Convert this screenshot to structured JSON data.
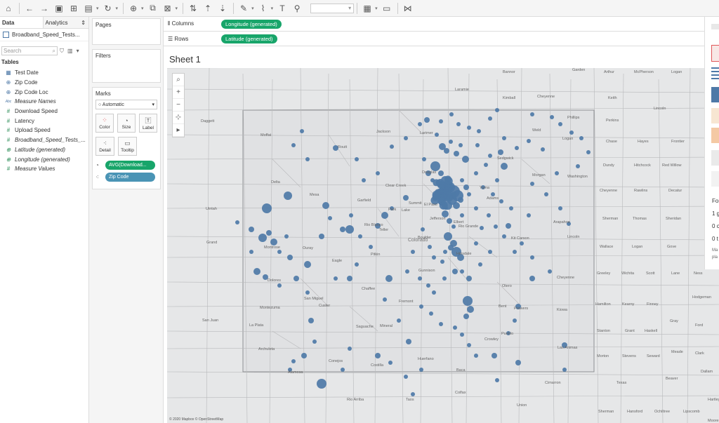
{
  "toolbar": {
    "icons": [
      "tableau-logo-icon",
      "back-icon",
      "forward-icon",
      "save-icon",
      "new-datasource-icon",
      "pause-icon",
      "refresh-icon",
      "new-sheet-icon",
      "duplicate-icon",
      "clear-icon",
      "swap-icon",
      "sort-asc-icon",
      "sort-desc-icon",
      "highlight-icon",
      "group-icon",
      "label-icon",
      "fix-axes-icon",
      "fit-icon",
      "show-cards-icon",
      "presentation-icon",
      "share-icon"
    ],
    "fit_value": ""
  },
  "data_pane": {
    "tab_data": "Data",
    "tab_analytics": "Analytics",
    "datasource": "Broadband_Speed_Tests...",
    "search_placeholder": "Search",
    "tables_heading": "Tables",
    "fields": [
      {
        "label": "Test Date",
        "icon": "calendar-icon"
      },
      {
        "label": "Zip Code",
        "icon": "globe-icon"
      },
      {
        "label": "Zip Code Loc",
        "icon": "globe-icon"
      },
      {
        "label": "Measure Names",
        "icon": "abc-icon"
      },
      {
        "label": "Download Speed",
        "icon": "hash-icon"
      },
      {
        "label": "Latency",
        "icon": "hash-icon"
      },
      {
        "label": "Upload Speed",
        "icon": "hash-icon"
      },
      {
        "label": "Broadband_Speed_Tests_...",
        "icon": "hash-icon"
      },
      {
        "label": "Latitude (generated)",
        "icon": "globe-icon"
      },
      {
        "label": "Longitude (generated)",
        "icon": "globe-icon"
      },
      {
        "label": "Measure Values",
        "icon": "hash-icon"
      }
    ]
  },
  "cards": {
    "pages": "Pages",
    "filters": "Filters",
    "marks": "Marks",
    "mark_type": "Automatic",
    "buttons": {
      "color": "Color",
      "size": "Size",
      "label": "Label",
      "detail": "Detail",
      "tooltip": "Tooltip"
    },
    "size_pill": "AVG(Download...",
    "detail_pill": "Zip Code"
  },
  "shelves": {
    "columns_label": "Columns",
    "columns_pill": "Longitude (generated)",
    "rows_label": "Rows",
    "rows_pill": "Latitude (generated)"
  },
  "sheet": {
    "title": "Sheet 1",
    "attribution": "© 2020 Mapbox © OpenStreetMap",
    "mark_color": "#4e79a7"
  },
  "map_labels": [
    "Bannor",
    "Garden",
    "Arthur",
    "McPherson",
    "Logan",
    "Laramie",
    "Kimball",
    "Cheyenne",
    "Keith",
    "Lincoln",
    "Perkins",
    "Chase",
    "Hayes",
    "Frontier",
    "Dundy",
    "Hitchcock",
    "Red Willow",
    "Cheyenne",
    "Rawlins",
    "Decatur",
    "Sherman",
    "Thomas",
    "Sheridan",
    "Wallace",
    "Logan",
    "Gove",
    "Greeley",
    "Wichita",
    "Scott",
    "Lane",
    "Ness",
    "Hamilton",
    "Kearny",
    "Finney",
    "Hodgeman",
    "Stanton",
    "Grant",
    "Haskell",
    "Gray",
    "Ford",
    "Morton",
    "Stevens",
    "Seward",
    "Meade",
    "Clark",
    "Cimarron",
    "Texas",
    "Beaver",
    "Sherman",
    "Hansford",
    "Ochiltree",
    "Lipscomb",
    "Dallam",
    "Hartley",
    "Moore",
    "Hutchinson",
    "Roberts",
    "Colfax",
    "Union",
    "Rio Arriba",
    "Taos",
    "Mora",
    "San Juan",
    "Grand",
    "Uintah",
    "Daggett",
    "Moffat",
    "Routt",
    "Jackson",
    "Larimer",
    "Weld",
    "Logan",
    "Phillips",
    "Sedgwick",
    "Morgan",
    "Washington",
    "Yuma",
    "Adams",
    "Arapahoe",
    "Kit Carson",
    "Lincoln",
    "Cheyenne",
    "Kiowa",
    "Prowers",
    "Bent",
    "Otero",
    "Crowley",
    "Pueblo",
    "Las Animas",
    "Baca",
    "Huerfano",
    "Costilla",
    "Conejos",
    "Alamosa",
    "Archuleta",
    "La Plata",
    "Montezuma",
    "Dolores",
    "San Miguel",
    "Montrose",
    "Ouray",
    "Mesa",
    "Delta",
    "Garfield",
    "Rio Blanco",
    "Eagle",
    "Pitkin",
    "Gunnison",
    "Chaffee",
    "Fremont",
    "Saguache",
    "Custer",
    "Mineral",
    "Rio Grande",
    "Hinsdale",
    "Elbert",
    "El Paso",
    "Douglas",
    "Jefferson",
    "Boulder",
    "Teller",
    "Park",
    "Lake",
    "Summit",
    "Clear Creek",
    "Gilpin",
    "Grand"
  ],
  "state_label": "Colorado",
  "right_pane": {
    "lines": [
      "For",
      "1 g",
      "0 o",
      "0 t",
      "Ma",
      "pla"
    ],
    "title_right": "Nel"
  }
}
